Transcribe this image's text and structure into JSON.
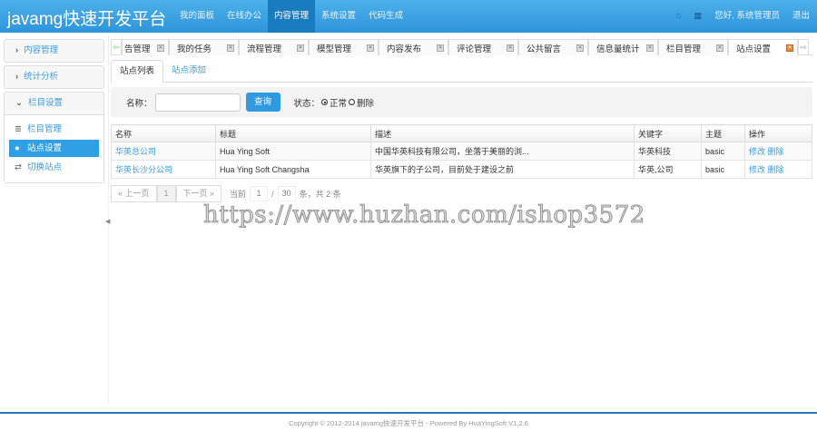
{
  "header": {
    "brand": "javamg快速开发平台",
    "nav": [
      "我的面板",
      "在线办公",
      "内容管理",
      "系统设置",
      "代码生成"
    ],
    "active_nav": 2,
    "greeting": "您好, 系统管理员",
    "logout": "退出"
  },
  "sidebar": {
    "panels": [
      {
        "label": "内容管理",
        "icon": "chevron-right-icon"
      },
      {
        "label": "统计分析",
        "icon": "chevron-right-icon"
      },
      {
        "label": "栏目设置",
        "icon": "chevron-down-icon"
      }
    ],
    "items": [
      {
        "label": "栏目管理",
        "icon": "list-icon"
      },
      {
        "label": "站点设置",
        "icon": "circle-icon"
      },
      {
        "label": "切换站点",
        "icon": "retweet-icon"
      }
    ],
    "active_item": 1
  },
  "tabs": [
    "告管理",
    "我的任务",
    "流程管理",
    "模型管理",
    "内容发布",
    "评论管理",
    "公共留言",
    "信息量统计",
    "栏目管理",
    "站点设置"
  ],
  "subtabs": [
    "站点列表",
    "站点添加"
  ],
  "search": {
    "name_label": "名称：",
    "name_value": "",
    "query_button": "查询",
    "status_label": "状态：",
    "status_options": [
      "正常",
      "删除"
    ],
    "status_selected": "正常"
  },
  "table": {
    "headers": [
      "名称",
      "标题",
      "描述",
      "关键字",
      "主题",
      "操作"
    ],
    "rows": [
      {
        "name": "华英总公司",
        "title": "Hua Ying Soft",
        "desc": "中国华英科技有限公司，坐落于美丽的浏...",
        "keywords": "华英科技",
        "theme": "basic",
        "edit": "修改",
        "delete": "删除"
      },
      {
        "name": "华英长沙分公司",
        "title": "Hua Ying Soft Changsha",
        "desc": "华英旗下的子公司，目前处于建设之前",
        "keywords": "华英,公司",
        "theme": "basic",
        "edit": "修改",
        "delete": "删除"
      }
    ]
  },
  "pager": {
    "prev": "« 上一页",
    "page": "1",
    "next": "下一页 »",
    "current_label": "当前",
    "current": "1",
    "sep": "/",
    "page_size": "30",
    "suffix": "条，共 2 条"
  },
  "watermark": "https://www.huzhan.com/ishop3572",
  "footer": "Copyright © 2012-2014 javamg快速开发平台 - Powered By HuaYingSoft V1.2.6"
}
